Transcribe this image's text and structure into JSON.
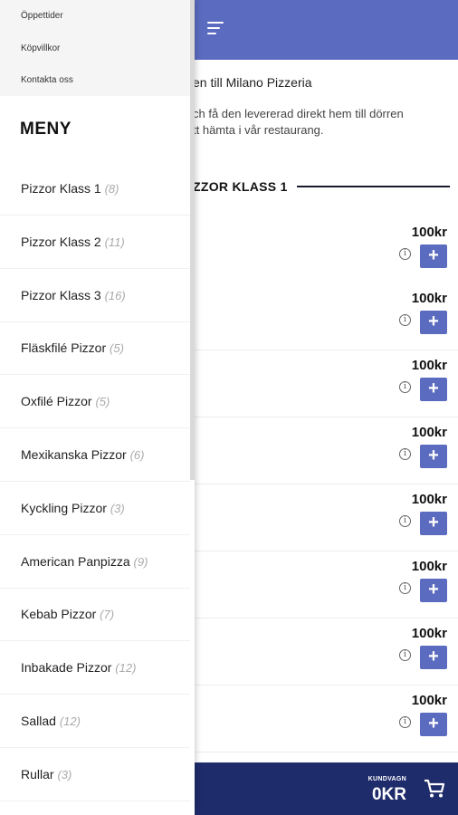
{
  "header": {
    "menu_icon": "hamburger-icon"
  },
  "intro": {
    "welcome": "en till Milano Pizzeria",
    "line1": "ch få den levererad direkt hem till dörren",
    "line2": "tt hämta i vår restaurang."
  },
  "section": {
    "heading": "ZZOR KLASS 1"
  },
  "products": [
    {
      "price": "100kr"
    },
    {
      "price": "100kr"
    },
    {
      "price": "100kr"
    },
    {
      "price": "100kr"
    },
    {
      "price": "100kr"
    },
    {
      "price": "100kr"
    },
    {
      "price": "100kr"
    },
    {
      "price": "100kr"
    }
  ],
  "product_info_glyph": "i",
  "product_add_glyph": "+",
  "cart": {
    "label": "KUNDVAGN",
    "total": "0KR",
    "icon": "cart-icon"
  },
  "drawer": {
    "top_links": [
      "Öppettider",
      "Köpvillkor",
      "Kontakta oss"
    ],
    "menu_title": "MENY",
    "categories": [
      {
        "name": "Pizzor Klass 1",
        "count": "(8)"
      },
      {
        "name": "Pizzor Klass 2",
        "count": "(11)"
      },
      {
        "name": "Pizzor Klass 3",
        "count": "(16)"
      },
      {
        "name": "Fläskfilé Pizzor",
        "count": "(5)"
      },
      {
        "name": "Oxfilé Pizzor",
        "count": "(5)"
      },
      {
        "name": "Mexikanska Pizzor",
        "count": "(6)"
      },
      {
        "name": "Kyckling Pizzor",
        "count": "(3)"
      },
      {
        "name": "American Panpizza",
        "count": "(9)"
      },
      {
        "name": "Kebab Pizzor",
        "count": "(7)"
      },
      {
        "name": "Inbakade Pizzor",
        "count": "(12)"
      },
      {
        "name": "Sallad",
        "count": "(12)"
      },
      {
        "name": "Rullar",
        "count": "(3)"
      }
    ]
  },
  "colors": {
    "accent": "#5b6bbf",
    "cartbar": "#1f2c6b"
  }
}
